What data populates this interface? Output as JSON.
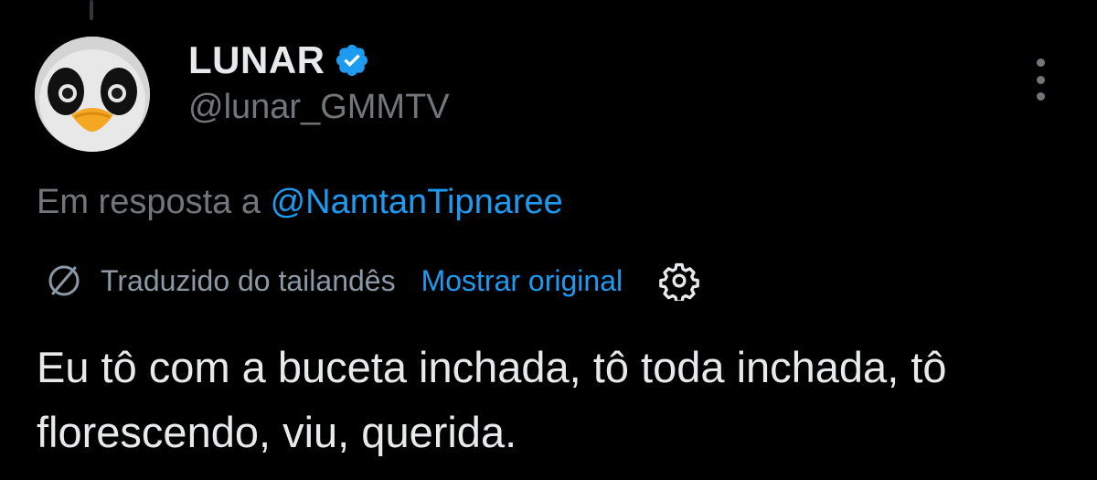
{
  "author": {
    "display_name": "LUNAR",
    "handle": "@lunar_GMMTV",
    "verified_icon": "verified-badge-icon",
    "avatar": "penguin-avatar"
  },
  "reply": {
    "prefix": "Em resposta a",
    "mention": "@NamtanTipnaree"
  },
  "translation": {
    "label": "Traduzido do tailandês",
    "show_original": "Mostrar original",
    "translate_icon": "translate-icon",
    "settings_icon": "gear-icon"
  },
  "tweet": {
    "text": "Eu tô com a buceta inchada, tô toda inchada, tô florescendo, viu, querida."
  },
  "colors": {
    "background": "#000000",
    "text": "#e7e9ea",
    "secondary": "#71767b",
    "link": "#1d9bf0"
  }
}
